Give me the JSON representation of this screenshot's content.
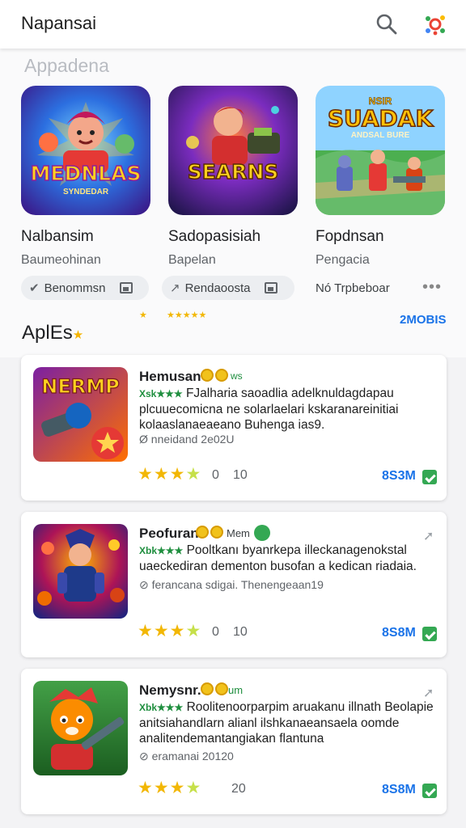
{
  "header": {
    "title": "Napansai"
  },
  "featured": {
    "section_title": "Appadena",
    "items": [
      {
        "name": "Nalbansim",
        "subtitle": "Baumeohinan",
        "art_text": "MEDNLAS",
        "art_sub": "SYNDEDAR"
      },
      {
        "name": "Sadopasisiah",
        "subtitle": "Bapelan",
        "art_text": "SEARNS"
      },
      {
        "name": "Fopdnsan",
        "subtitle": "Pengacia",
        "art_text": "SUADAK",
        "art_top": "NSIR",
        "art_sub": "ANDSAL BURE"
      }
    ]
  },
  "chips": [
    {
      "label": "Benommsn"
    },
    {
      "label": "Rendaoosta"
    },
    {
      "label": "Nó Trpbeboar"
    }
  ],
  "stars_row": {
    "left": "★",
    "right": "★★★★★"
  },
  "apps_section": {
    "title": "AplEs",
    "see_more": "2MOBIS"
  },
  "apps": [
    {
      "name": "Hemusan",
      "tag": "ws",
      "rating_prefix": "Xsk★★★",
      "desc_first": "FJalharia saoadlia adelknuldagdapau",
      "desc_rest": "plcuuecomicna ne solarlaelari kskaranareinitiai kolaaslanaeaeano Buhenga ias9.",
      "meta": "Ø nneidand 2e02U",
      "rating_count": "0",
      "rating_label": "10",
      "size": "8S3M",
      "art_text": "NERMP"
    },
    {
      "name": "Peofuran",
      "tag": "Mem",
      "rating_prefix": "Xbk★★★",
      "desc_first": "Pooltkanı byanrkepa illeckanagenokstal",
      "desc_rest": "uaeckediran dementon busofan a kedican riadaia.",
      "meta": "⊘ ferancana sdigai. Thenengeaan19",
      "rating_count": "0",
      "rating_label": "10",
      "size": "8S8M"
    },
    {
      "name": "Nemysnr.",
      "tag": "um",
      "rating_prefix": "Xbk★★★",
      "desc_first": "Roolitenoorparpim aruakanu illnath",
      "desc_rest": "Beolapie anitsiahandlarn alianl ilshkanaeansaela oomde analitendemantangiakan flantuna",
      "meta": "⊘ eramanai 20120",
      "rating_count": "",
      "rating_label": "20",
      "size": "8S8M"
    }
  ],
  "colors": {
    "accent": "#1a73e8",
    "star": "#f2b705",
    "install": "#34a853"
  }
}
